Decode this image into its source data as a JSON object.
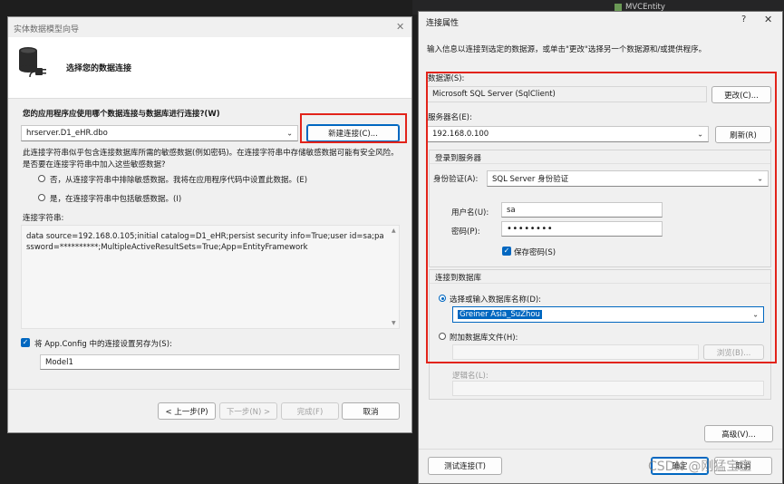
{
  "background": {
    "tree_item": "MVCEntity",
    "watermark": "CSDN @刚猛宝宝"
  },
  "wizard": {
    "title": "实体数据模型向导",
    "header": "选择您的数据连接",
    "question": "您的应用程序应使用哪个数据连接与数据库进行连接?(W)",
    "connection_select": "hrserver.D1_eHR.dbo",
    "new_connection_button": "新建连接(C)...",
    "warning_text": "此连接字符串似乎包含连接数据库所需的敏感数据(例如密码)。在连接字符串中存储敏感数据可能有安全风险。是否要在连接字符串中加入这些敏感数据?",
    "radio_exclude": "否，从连接字符串中排除敏感数据。我将在应用程序代码中设置此数据。(E)",
    "radio_include": "是，在连接字符串中包括敏感数据。(I)",
    "conn_string_label": "连接字符串:",
    "conn_string_value": "data source=192.168.0.105;initial catalog=D1_eHR;persist security info=True;user id=sa;password=**********;MultipleActiveResultSets=True;App=EntityFramework",
    "save_checkbox_label": "将 App.Config 中的连接设置另存为(S):",
    "save_name": "Model1",
    "buttons": {
      "prev": "< 上一步(P)",
      "next": "下一步(N) >",
      "finish": "完成(F)",
      "cancel": "取消"
    }
  },
  "conn_props": {
    "title": "连接属性",
    "help_glyph": "?",
    "description": "输入信息以连接到选定的数据源，或单击\"更改\"选择另一个数据源和/或提供程序。",
    "datasource_label": "数据源(S):",
    "datasource_value": "Microsoft SQL Server (SqlClient)",
    "change_button": "更改(C)...",
    "server_label": "服务器名(E):",
    "server_value": "192.168.0.100",
    "refresh_button": "刷新(R)",
    "login_group": "登录到服务器",
    "auth_label": "身份验证(A):",
    "auth_value": "SQL Server 身份验证",
    "username_label": "用户名(U):",
    "username_value": "sa",
    "password_label": "密码(P):",
    "password_value": "••••••••",
    "save_password_label": "保存密码(S)",
    "db_group": "连接到数据库",
    "select_db_label": "选择或输入数据库名称(D):",
    "db_value": "Greiner Asia_SuZhou",
    "attach_file_label": "附加数据库文件(H):",
    "browse_button": "浏览(B)...",
    "logical_name_label": "逻辑名(L):",
    "advanced_button": "高级(V)...",
    "test_button": "测试连接(T)",
    "ok_button": "确定",
    "cancel_button": "取消"
  }
}
